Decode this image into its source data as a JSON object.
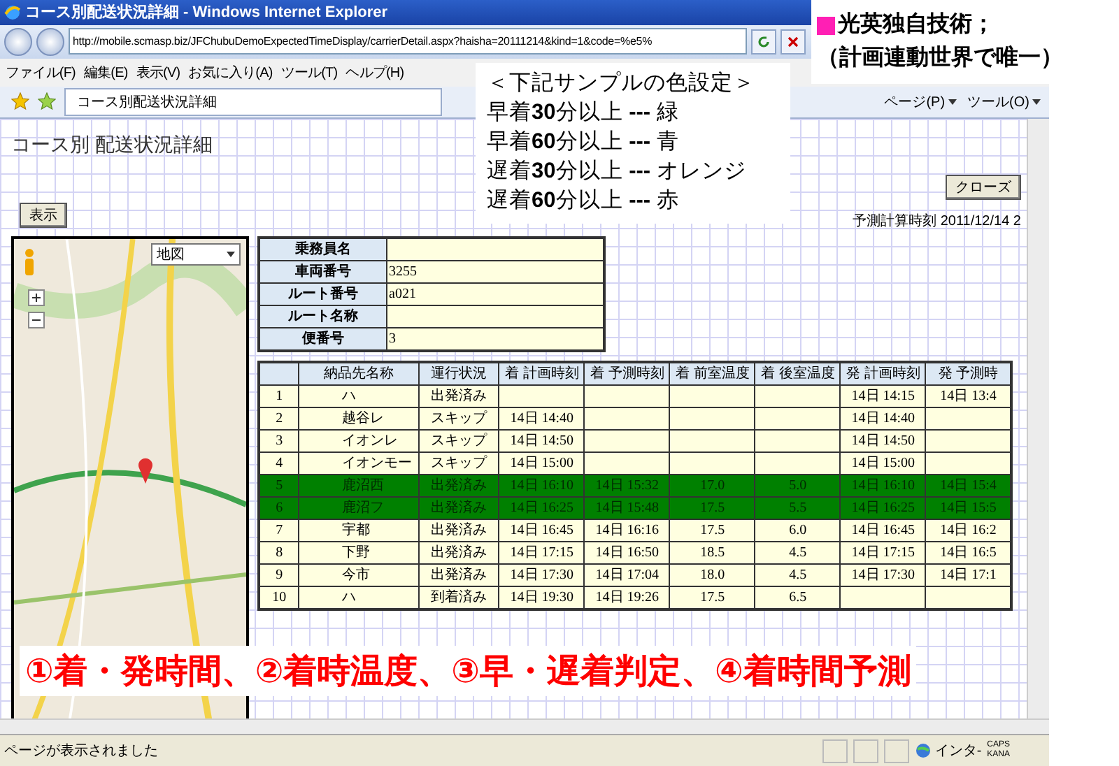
{
  "window": {
    "title": "コース別配送状況詳細 - Windows Internet Explorer"
  },
  "address_bar": {
    "url": "http://mobile.scmasp.biz/JFChubuDemoExpectedTimeDisplay/carrierDetail.aspx?haisha=20111214&kind=1&code=%e5%"
  },
  "menu": [
    "ファイル(F)",
    "編集(E)",
    "表示(V)",
    "お気に入り(A)",
    "ツール(T)",
    "ヘルプ(H)"
  ],
  "tab": {
    "title": "コース別配送状況詳細"
  },
  "command_bar": [
    "ページ(P)",
    "ツール(O)"
  ],
  "page": {
    "heading": "コース別 配送状況詳細",
    "show_button": "表示",
    "close_button": "クローズ",
    "calc_time": "予測計算時刻 2011/12/14 2",
    "map_type": "地図"
  },
  "info_table": [
    {
      "label": "乗務員名"
    },
    {
      "label": "車両番号",
      "value": "3255"
    },
    {
      "label": "ルート番号",
      "value": "a021"
    },
    {
      "label": "ルート名称"
    },
    {
      "label": "便番号",
      "value": "3"
    }
  ],
  "delivery_table": {
    "columns": [
      "納品先名称",
      "運行状況",
      "着 計画時刻",
      "着 予測時刻",
      "着 前室温度",
      "着 後室温度",
      "発 計画時刻",
      "発 予測時"
    ],
    "rows": [
      {
        "no": "1",
        "name": "ハ",
        "status": "出発済み",
        "dep_plan": "14日 14:15",
        "dep_pred": "14日 13:4",
        "color": "#ffffe0"
      },
      {
        "no": "2",
        "name": "越谷レ",
        "status": "スキップ",
        "arr_plan": "14日 14:40",
        "dep_plan": "14日 14:40",
        "color": "#ffffe0"
      },
      {
        "no": "3",
        "name": "イオンレ",
        "status": "スキップ",
        "arr_plan": "14日 14:50",
        "dep_plan": "14日 14:50",
        "color": "#ffffe0"
      },
      {
        "no": "4",
        "name": "イオンモー",
        "status": "スキップ",
        "arr_plan": "14日 15:00",
        "dep_plan": "14日 15:00",
        "color": "#ffffe0"
      },
      {
        "no": "5",
        "name": "鹿沼西",
        "status": "出発済み",
        "arr_plan": "14日 16:10",
        "arr_pred": "14日 15:32",
        "front_temp": "17.0",
        "rear_temp": "5.0",
        "dep_plan": "14日 16:10",
        "dep_pred": "14日 15:4",
        "color": "#008000"
      },
      {
        "no": "6",
        "name": "鹿沼フ",
        "status": "出発済み",
        "arr_plan": "14日 16:25",
        "arr_pred": "14日 15:48",
        "front_temp": "17.5",
        "rear_temp": "5.5",
        "dep_plan": "14日 16:25",
        "dep_pred": "14日 15:5",
        "color": "#008000"
      },
      {
        "no": "7",
        "name": "宇都",
        "status": "出発済み",
        "arr_plan": "14日 16:45",
        "arr_pred": "14日 16:16",
        "front_temp": "17.5",
        "rear_temp": "6.0",
        "dep_plan": "14日 16:45",
        "dep_pred": "14日 16:2",
        "color": "#ffffe0"
      },
      {
        "no": "8",
        "name": "下野",
        "status": "出発済み",
        "arr_plan": "14日 17:15",
        "arr_pred": "14日 16:50",
        "front_temp": "18.5",
        "rear_temp": "4.5",
        "dep_plan": "14日 17:15",
        "dep_pred": "14日 16:5",
        "color": "#ffffe0"
      },
      {
        "no": "9",
        "name": "今市",
        "status": "出発済み",
        "arr_plan": "14日 17:30",
        "arr_pred": "14日 17:04",
        "front_temp": "18.0",
        "rear_temp": "4.5",
        "dep_plan": "14日 17:30",
        "dep_pred": "14日 17:1",
        "color": "#ffffe0"
      },
      {
        "no": "10",
        "name": "ハ",
        "status": "到着済み",
        "arr_plan": "14日 19:30",
        "arr_pred": "14日 19:26",
        "front_temp": "17.5",
        "rear_temp": "6.5",
        "color": "#ffffe0"
      }
    ]
  },
  "status_bar": {
    "text": "ページが表示されました",
    "zone": "インタ-",
    "keys": [
      "CAPS",
      "KANA"
    ]
  },
  "callout": {
    "title": "＜下記サンプルの色設定＞",
    "lines": [
      "早着**30**分以上 **---** 緑",
      "早着**60**分以上 **---** 青",
      "遅着**30**分以上 **---** オレンジ",
      "遅着**60**分以上 **---** 赤"
    ]
  },
  "annotation": {
    "title": "光英独自技術；",
    "subtitle": "（計画連動世界で唯一）"
  },
  "banner": {
    "text": "①着・発時間、②着時温度、③早・遅着判定、④着時間予測"
  }
}
